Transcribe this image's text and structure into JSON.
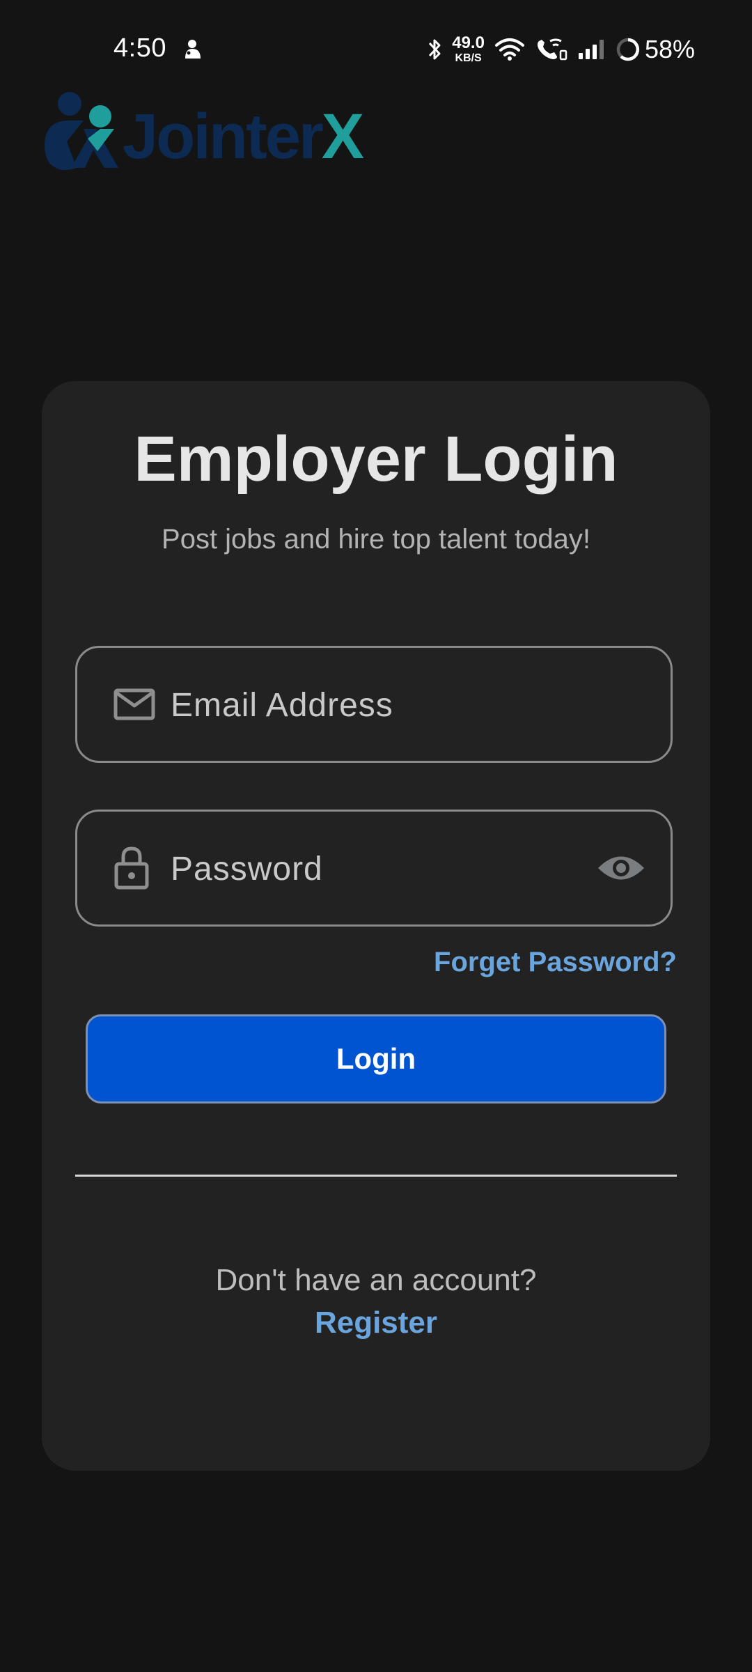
{
  "status_bar": {
    "time": "4:50",
    "net_speed_value": "49.0",
    "net_speed_unit": "KB/S",
    "battery": "58%",
    "icons": [
      "app-notification-icon",
      "bluetooth-icon",
      "wifi-icon",
      "wifi-call-icon",
      "signal-icon",
      "battery-ring-icon"
    ]
  },
  "logo": {
    "text_part1": "Jointer",
    "text_part2": "X",
    "colors": {
      "navy": "#0c2a52",
      "teal": "#1f9e9c"
    }
  },
  "login_card": {
    "title": "Employer Login",
    "subtitle": "Post jobs and hire top talent today!",
    "email_placeholder": "Email Address",
    "password_placeholder": "Password",
    "forgot_password": "Forget Password?",
    "login_button": "Login",
    "no_account_text": "Don't have an account?",
    "register_link": "Register"
  },
  "icons": {
    "email": "mail-icon",
    "password": "lock-icon",
    "toggle_visibility": "eye-icon"
  },
  "colors": {
    "background": "#141414",
    "card": "#222222",
    "primary_button": "#0054d0",
    "link": "#6aa5dd"
  }
}
